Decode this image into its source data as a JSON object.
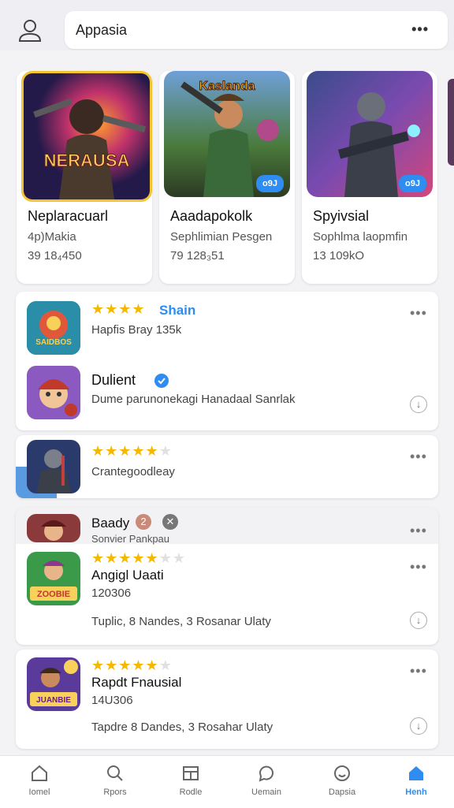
{
  "search": {
    "value": "Appasia"
  },
  "featured": [
    {
      "art_text": "NERAUSA",
      "title": "Neplaracuarl",
      "subtitle": "4p)Makia",
      "meta": "39 18₄450",
      "badge": ""
    },
    {
      "art_text": "Kaslanda",
      "title": "Aaadapokolk",
      "subtitle": "Sephlimian Pesgen",
      "meta": "79 128₃51",
      "badge": "o9J"
    },
    {
      "art_text": "",
      "title": "Spyivsial",
      "subtitle": "Sophlma laopmfin",
      "meta": "13 109kO",
      "badge": "o9J"
    }
  ],
  "list": [
    {
      "tag": "Shain",
      "detail": "Hapfis Bray 135k",
      "icon_text": "SAIDBOS"
    },
    {
      "title": "Dulient",
      "detail": "Dume parunonekagi Hanadaal Sanrlak"
    },
    {
      "detail": "Crantegoodleay"
    },
    {
      "title": "Baady",
      "badge_num": "2",
      "detail": "Sonvier Pankpau"
    },
    {
      "title": "Angigl Uaati",
      "meta": "120306",
      "detail": "Tuplic, 8 Nandes, 3 Rosanar Ulaty",
      "icon_text": "ZOOBIE"
    },
    {
      "title": "Rapdt Fnausial",
      "meta": "14U306",
      "detail": "Tapdre 8 Dandes, 3 Rosahar Ulaty",
      "icon_text": "JUANBIE"
    }
  ],
  "nav": [
    {
      "label": "Iomel",
      "icon": "home-outline-icon"
    },
    {
      "label": "Rpors",
      "icon": "search-icon"
    },
    {
      "label": "Rodle",
      "icon": "grid-icon"
    },
    {
      "label": "Uemain",
      "icon": "chat-icon"
    },
    {
      "label": "Dapsia",
      "icon": "face-icon"
    },
    {
      "label": "Henh",
      "icon": "home-filled-icon"
    }
  ],
  "colors": {
    "accent": "#2f8cf0",
    "star": "#f5b800"
  }
}
